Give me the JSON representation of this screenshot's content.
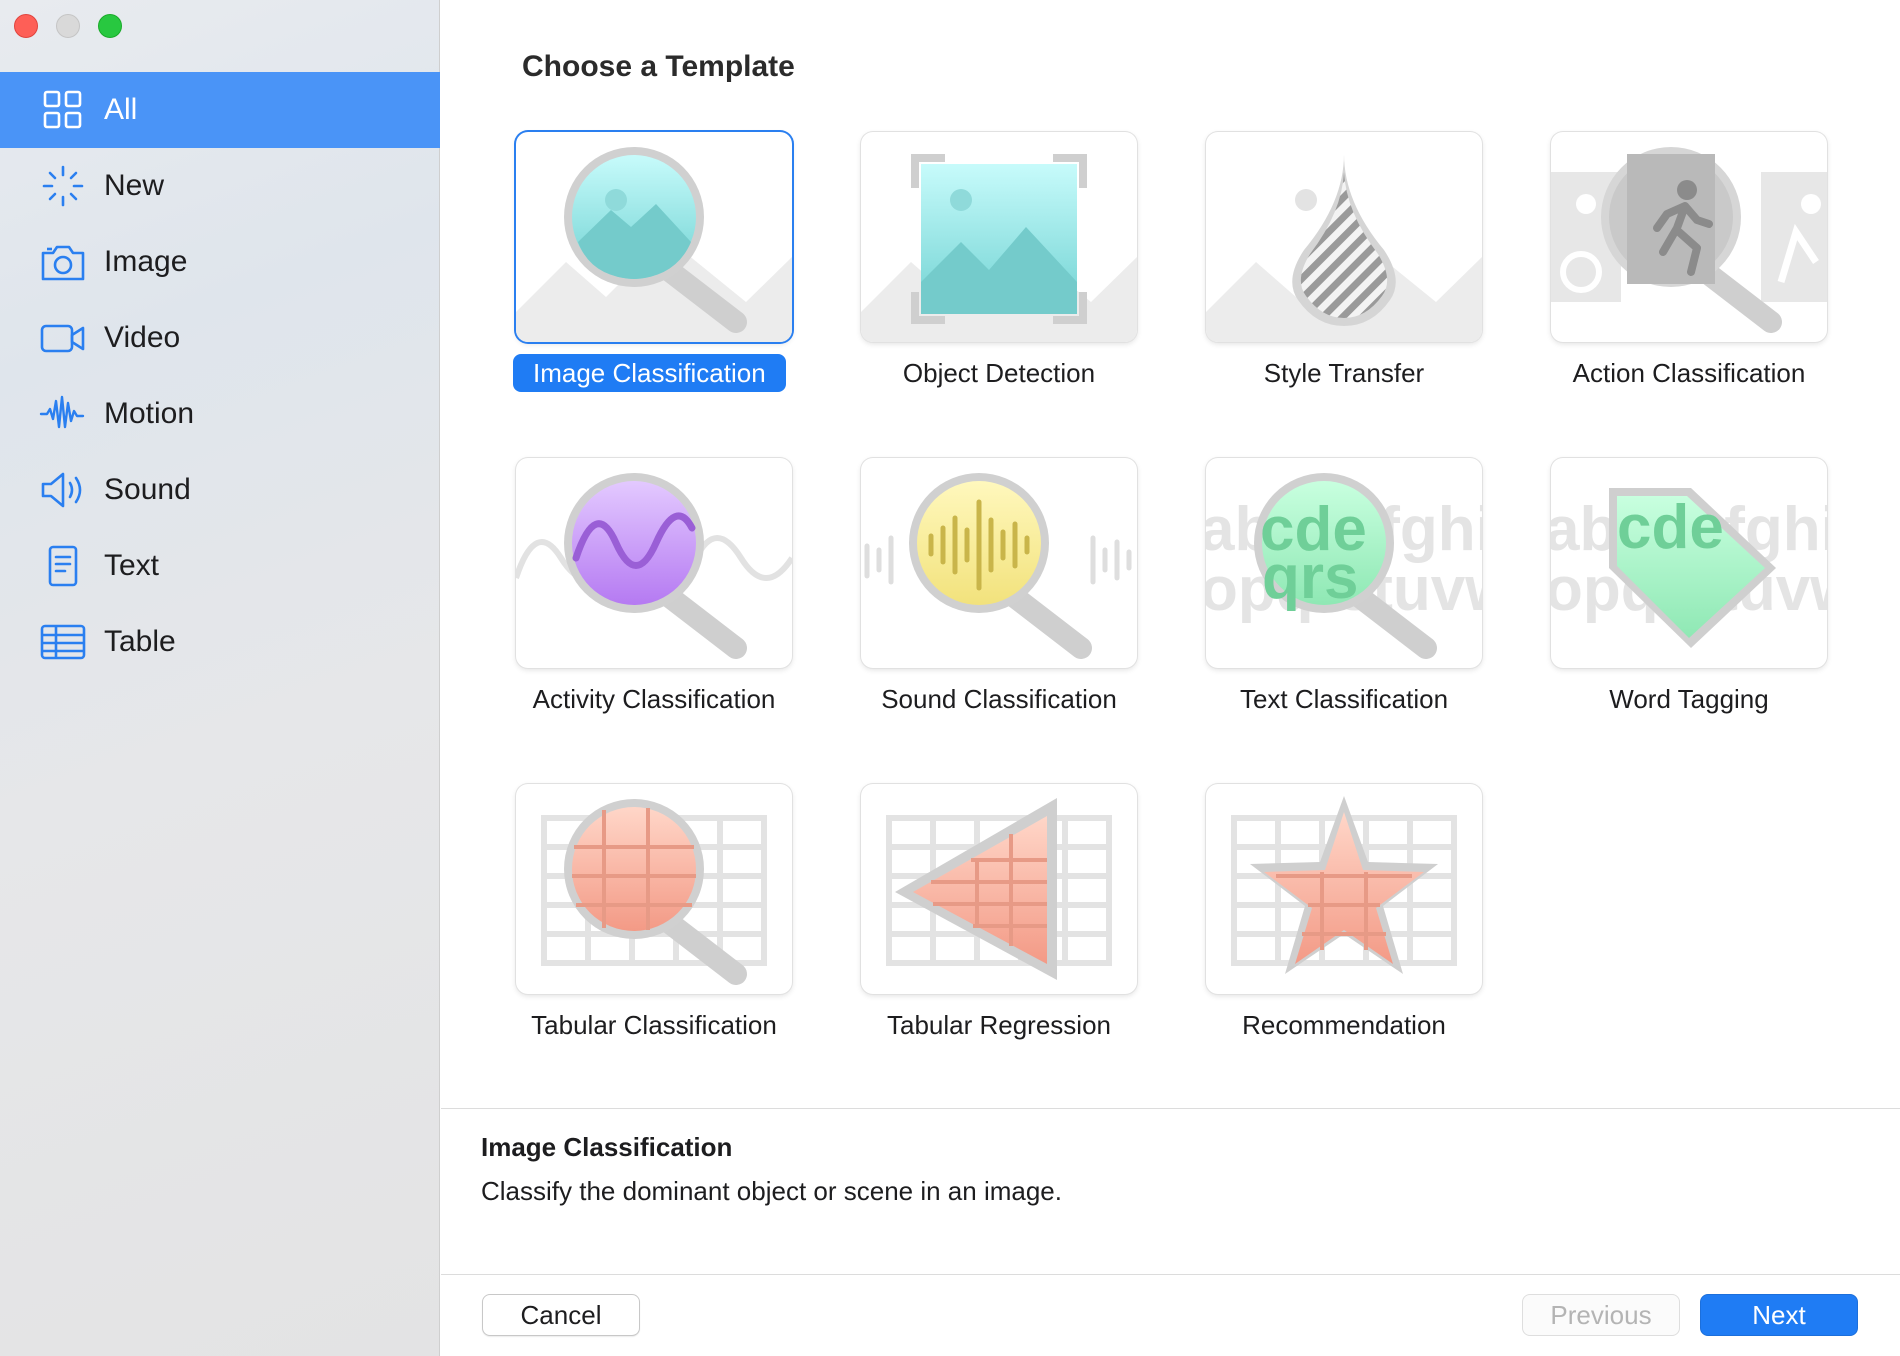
{
  "window": {
    "controls": [
      "close",
      "minimize",
      "zoom"
    ]
  },
  "sidebar": {
    "items": [
      {
        "label": "All",
        "icon": "grid-icon",
        "selected": true
      },
      {
        "label": "New",
        "icon": "sparkle-icon",
        "selected": false
      },
      {
        "label": "Image",
        "icon": "camera-icon",
        "selected": false
      },
      {
        "label": "Video",
        "icon": "video-camera-icon",
        "selected": false
      },
      {
        "label": "Motion",
        "icon": "waveform-icon",
        "selected": false
      },
      {
        "label": "Sound",
        "icon": "speaker-icon",
        "selected": false
      },
      {
        "label": "Text",
        "icon": "document-icon",
        "selected": false
      },
      {
        "label": "Table",
        "icon": "table-icon",
        "selected": false
      }
    ]
  },
  "main": {
    "title": "Choose a Template",
    "templates": [
      {
        "label": "Image Classification",
        "icon": "image-magnifier-icon",
        "selected": true
      },
      {
        "label": "Object Detection",
        "icon": "image-bounding-box-icon",
        "selected": false
      },
      {
        "label": "Style Transfer",
        "icon": "drop-icon",
        "selected": false
      },
      {
        "label": "Action Classification",
        "icon": "person-magnifier-icon",
        "selected": false
      },
      {
        "label": "Activity Classification",
        "icon": "wave-magnifier-icon",
        "selected": false
      },
      {
        "label": "Sound Classification",
        "icon": "audio-magnifier-icon",
        "selected": false
      },
      {
        "label": "Text Classification",
        "icon": "text-magnifier-icon",
        "selected": false
      },
      {
        "label": "Word Tagging",
        "icon": "text-tag-icon",
        "selected": false
      },
      {
        "label": "Tabular Classification",
        "icon": "table-magnifier-icon",
        "selected": false
      },
      {
        "label": "Tabular Regression",
        "icon": "table-triangle-icon",
        "selected": false
      },
      {
        "label": "Recommendation",
        "icon": "table-star-icon",
        "selected": false
      }
    ],
    "tile_text": {
      "alphabet_row1": "abcdefghi",
      "alphabet_row2": "opqrstuvw"
    }
  },
  "description": {
    "title": "Image Classification",
    "text": "Classify the dominant object or scene in an image."
  },
  "footer": {
    "cancel_label": "Cancel",
    "previous_label": "Previous",
    "next_label": "Next",
    "previous_enabled": false
  },
  "colors": {
    "accent": "#1f7cf4",
    "sidebar_selected": "#4a94f7",
    "close": "#fe5f57",
    "zoom": "#28c840"
  }
}
